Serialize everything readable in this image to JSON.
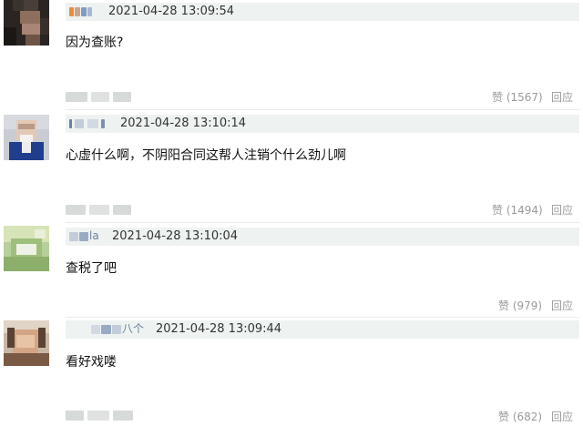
{
  "comments": [
    {
      "username": "",
      "timestamp": "2021-04-28 13:09:54",
      "text": "因为查账?",
      "like_label": "赞 (1567)",
      "reply_label": "回应"
    },
    {
      "username": "",
      "timestamp": "2021-04-28 13:10:14",
      "text": "心虚什么啊，不阴阳合同这帮人注销个什么劲儿啊",
      "like_label": "赞 (1494)",
      "reply_label": "回应"
    },
    {
      "username": "la",
      "timestamp": "2021-04-28 13:10:04",
      "text": "查税了吧",
      "like_label": "赞 (979)",
      "reply_label": "回应"
    },
    {
      "username": "八个",
      "timestamp": "2021-04-28 13:09:44",
      "text": "看好戏喽",
      "like_label": "赞 (682)",
      "reply_label": "回应"
    }
  ],
  "colors": {
    "meta_bar": "#eef3f1",
    "username": "#6b7fa0",
    "action": "#9a9a9a",
    "text": "#111111"
  }
}
